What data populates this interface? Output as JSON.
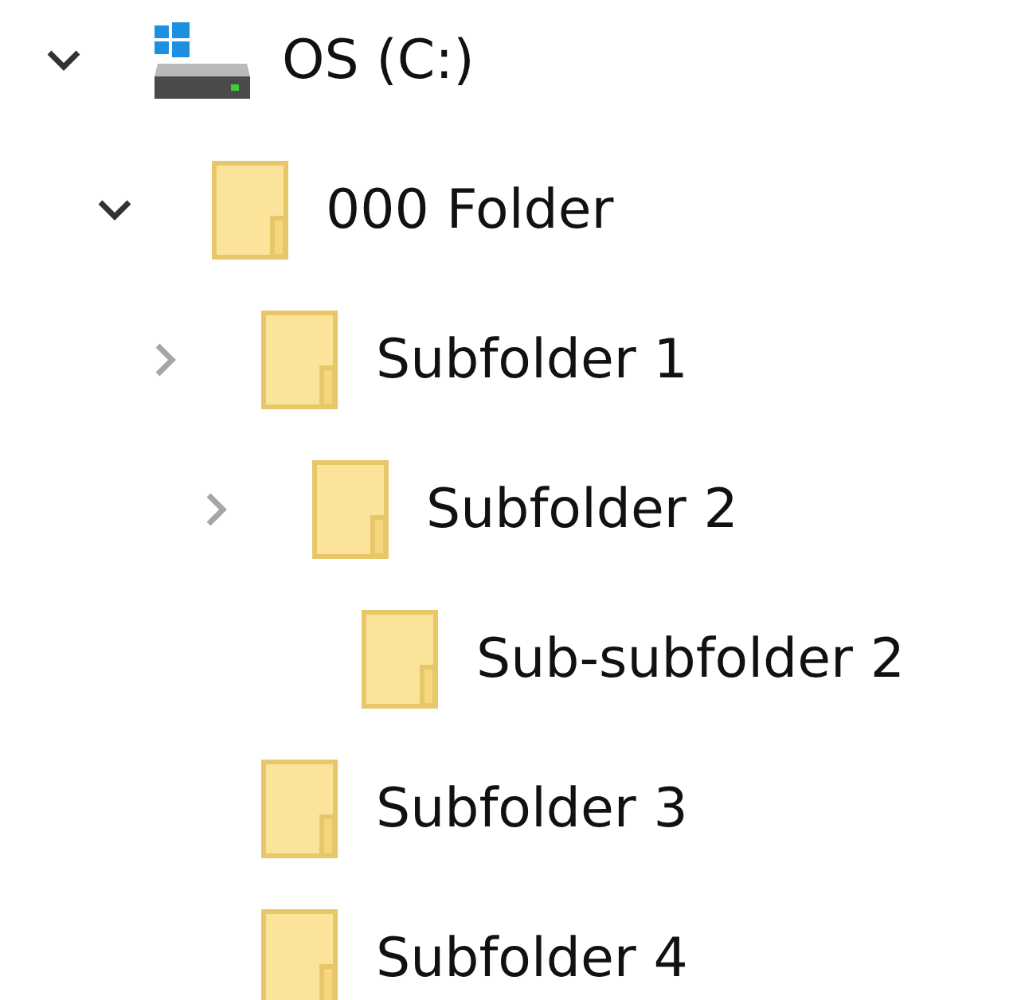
{
  "tree": [
    {
      "label": "OS (C:)",
      "kind": "drive",
      "expanded": true,
      "children": [
        {
          "label": "000 Folder",
          "kind": "folder",
          "expanded": true,
          "children": [
            {
              "label": "Subfolder 1",
              "kind": "folder",
              "expanded": false,
              "children": [
                {
                  "label": "Subfolder 2",
                  "kind": "folder",
                  "expanded": false,
                  "children": [
                    {
                      "label": "Sub-subfolder 2",
                      "kind": "folder"
                    }
                  ]
                }
              ]
            },
            {
              "label": "Subfolder 3",
              "kind": "folder"
            },
            {
              "label": "Subfolder 4",
              "kind": "folder"
            }
          ]
        }
      ]
    }
  ]
}
